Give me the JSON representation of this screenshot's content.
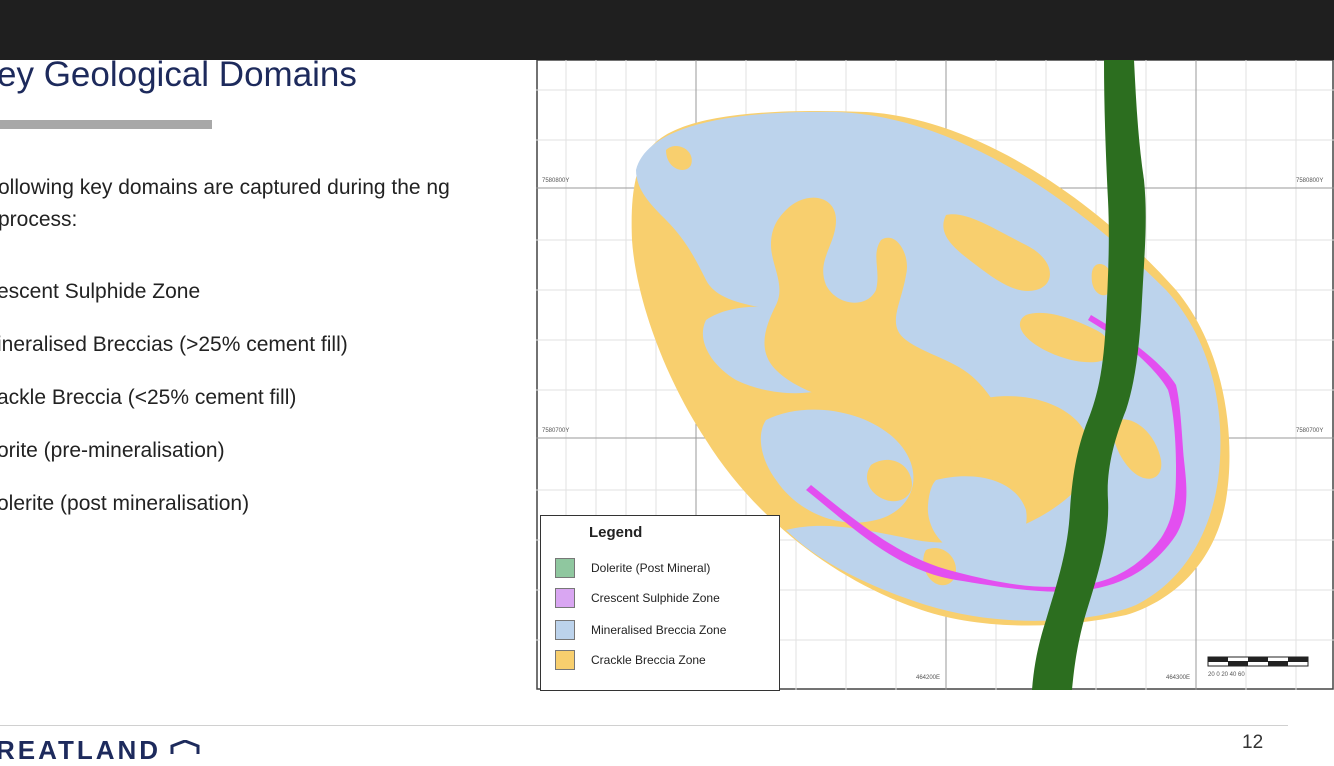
{
  "slide": {
    "title": "ey Geological Domains",
    "intro": "ollowing key domains are captured during the ng process:",
    "items": [
      "escent Sulphide Zone",
      "ineralised Breccias (>25% cement fill)",
      "ackle Breccia (<25% cement fill)",
      "orite (pre-mineralisation)",
      "olerite (post mineralisation)"
    ],
    "page_number": "12",
    "logo_text": "REATLAND"
  },
  "map": {
    "legend_title": "Legend",
    "legend": [
      {
        "label": "Dolerite (Post Mineral)",
        "color": "#8fc79f"
      },
      {
        "label": "Crescent Sulphide Zone",
        "color": "#d9a6f2"
      },
      {
        "label": "Mineralised Breccia Zone",
        "color": "#bcd3ec"
      },
      {
        "label": "Crackle Breccia Zone",
        "color": "#f8cf6e"
      }
    ],
    "grid_labels": {
      "n1_left": "7580800Y",
      "n1_right": "7580800Y",
      "n2_left": "7580700Y",
      "n2_right": "7580700Y",
      "e1": "464200E",
      "e2": "464300E"
    },
    "scale_text": "20 0 20 40 60",
    "colors": {
      "dolerite": "#2c6e1f",
      "crescent": "#e34ff0",
      "breccia": "#bcd3ec",
      "crackle": "#f8cf6e",
      "accent_title": "#1d2a5c"
    }
  }
}
